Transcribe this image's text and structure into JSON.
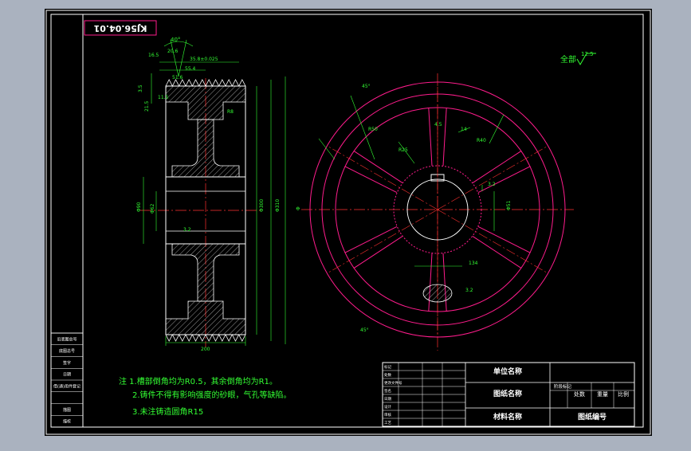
{
  "drawing": {
    "part_number": "KJ56.04.01",
    "roughness_note": "全部",
    "roughness_value": "12.5",
    "background_color": "#000000",
    "paper_gray": "#aab2bf"
  },
  "notes": {
    "line1": "注  1.槽部倒角均为R0.5，其余倒角均为R1。",
    "line2": "2.铸件不得有影响强度的砂眼，气孔等缺陷。",
    "line3": "3.未注铸造圆角R15"
  },
  "side_view_dims": {
    "top_angle": "40°",
    "a1": "16.5",
    "a2": "20.6",
    "a3": "51.6",
    "a4": "35.8±0.025",
    "a5": "55.4",
    "r1": "R0.5",
    "r2": "R1",
    "h1": "3.5",
    "h2": "21.5",
    "h3": "11.5",
    "r3": "R8",
    "d_inner": "Φ90",
    "d_hub": "Φ62",
    "d_pitch": "Φ300",
    "d_outer": "Φ310",
    "rough_side": "3.2",
    "width_bottom": "200"
  },
  "front_view_dims": {
    "angle_top": "45°",
    "angle_bottom": "45°",
    "r_arc": "R50",
    "r_spoke": "R25",
    "w_spoke": "4.5",
    "w_key": "14",
    "depth_key": "3.2",
    "d_bore": "Φ51",
    "d_label": "Φ",
    "r_outer": "R40",
    "w_slot": "134",
    "rough_key": "3.2"
  },
  "left_table": {
    "rows": [
      "旧底图总号",
      "底图总号",
      "签字",
      "日期",
      "借(通)用件登记",
      "",
      "描图",
      "描校"
    ]
  },
  "title_block": {
    "company": "单位名称",
    "drawing_name": "图纸名称",
    "material": "材料名称",
    "drawing_no": "图纸编号",
    "stage": "阶段标记",
    "weight": "重量",
    "scale": "比例",
    "qty_label": "处数",
    "row_labels": [
      "标记",
      "处数",
      "更改文件号",
      "签名",
      "日期"
    ],
    "sign_rows": [
      "设计",
      "审核",
      "工艺",
      "标准化",
      "批准"
    ],
    "small": [
      "共 张",
      "第 张"
    ]
  },
  "colors": {
    "frame": "#ffffff",
    "outline": "#ffffff",
    "red_center": "#ff3030",
    "magenta": "#ff1c8c",
    "green": "#33ff33",
    "label_white": "#ffffff"
  }
}
